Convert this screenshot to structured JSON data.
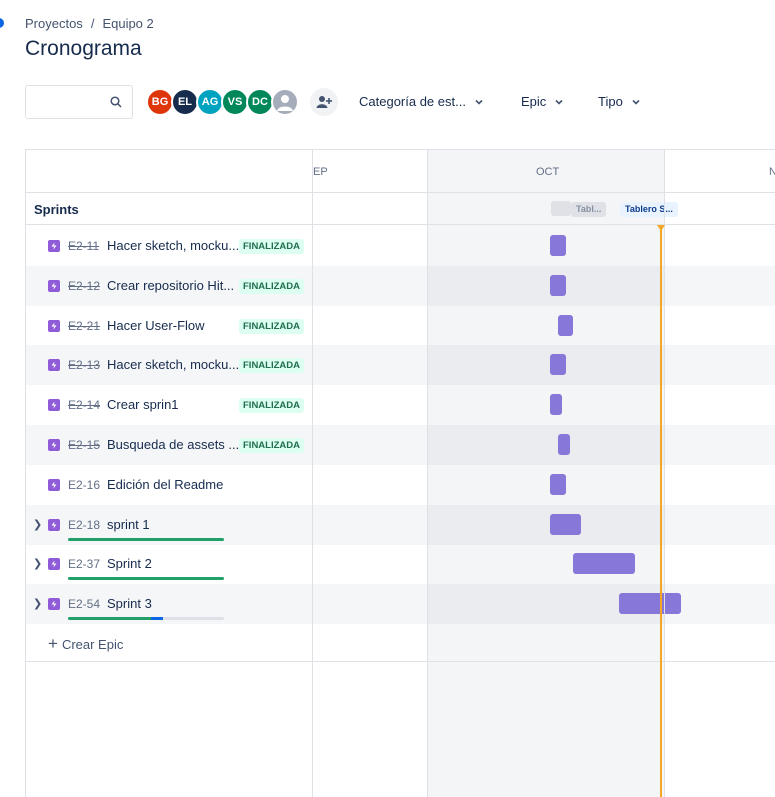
{
  "breadcrumb": {
    "projects": "Proyectos",
    "separator": "/",
    "team": "Equipo 2"
  },
  "page_title": "Cronograma",
  "search": {
    "placeholder": ""
  },
  "avatars": [
    {
      "initials": "BG",
      "color": "#de350b"
    },
    {
      "initials": "EL",
      "color": "#172b4d"
    },
    {
      "initials": "AG",
      "color": "#00a3bf"
    },
    {
      "initials": "VS",
      "color": "#00875a"
    },
    {
      "initials": "DC",
      "color": "#00875a"
    },
    {
      "initials": "",
      "icon": "user-icon",
      "color": "#a5adba"
    }
  ],
  "filters": {
    "status_category": "Categoría de est...",
    "epic": "Epic",
    "type": "Tipo"
  },
  "timeline": {
    "months": [
      "EP",
      "OCT",
      "N"
    ],
    "sprints_label": "Sprints",
    "sprints": [
      {
        "label": "Tabl...",
        "state": "closed"
      },
      {
        "label": "Tablero S...",
        "state": "active"
      }
    ],
    "rows": [
      {
        "key": "E2-11",
        "summary": "Hacer sketch, mocku...",
        "status": "FINALIZADA",
        "done": true
      },
      {
        "key": "E2-12",
        "summary": "Crear repositorio Hit...",
        "status": "FINALIZADA",
        "done": true
      },
      {
        "key": "E2-21",
        "summary": "Hacer User-Flow",
        "status": "FINALIZADA",
        "done": true
      },
      {
        "key": "E2-13",
        "summary": "Hacer sketch, mocku...",
        "status": "FINALIZADA",
        "done": true
      },
      {
        "key": "E2-14",
        "summary": "Crear sprin1",
        "status": "FINALIZADA",
        "done": true
      },
      {
        "key": "E2-15",
        "summary": "Busqueda de assets ...",
        "status": "FINALIZADA",
        "done": true
      },
      {
        "key": "E2-16",
        "summary": "Edición del Readme",
        "status": "",
        "done": false
      },
      {
        "key": "E2-18",
        "summary": "sprint 1",
        "status": "",
        "done": false,
        "expandable": true,
        "progress": {
          "done": 1.0,
          "in_progress": 0.0
        }
      },
      {
        "key": "E2-37",
        "summary": "Sprint 2",
        "status": "",
        "done": false,
        "expandable": true,
        "progress": {
          "done": 1.0,
          "in_progress": 0.0
        }
      },
      {
        "key": "E2-54",
        "summary": "Sprint 3",
        "status": "",
        "done": false,
        "expandable": true,
        "progress": {
          "done": 0.53,
          "in_progress": 0.08
        }
      }
    ],
    "create_epic": "Crear Epic"
  },
  "colors": {
    "bar": "#8777d9",
    "issue_icon": "#8f5bd9",
    "today": "#f5a623",
    "done": "#22a06b",
    "in_progress": "#0c66e4"
  }
}
